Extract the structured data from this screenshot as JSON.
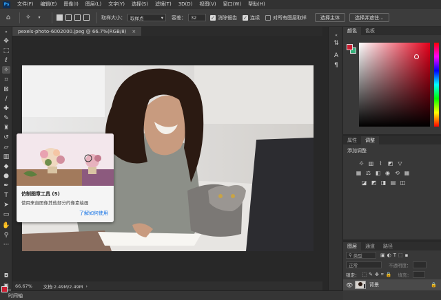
{
  "app": {
    "logo": "Ps"
  },
  "menu": [
    "文件(F)",
    "编辑(E)",
    "图像(I)",
    "图层(L)",
    "文字(Y)",
    "选择(S)",
    "滤镜(T)",
    "3D(D)",
    "视图(V)",
    "窗口(W)",
    "帮助(H)"
  ],
  "options": {
    "sample_size_label": "取样大小：",
    "sample_size_value": "取样点",
    "tolerance_label": "容差：",
    "tolerance_value": "32",
    "antialias_label": "消除锯齿",
    "contiguous_label": "连续",
    "sample_all_label": "对所有图层取样",
    "select_subject_label": "选择主体",
    "select_and_mask_label": "选择并遮住..."
  },
  "document": {
    "tab_title": "pexels-photo-6002000.jpeg @ 66.7%(RGB/8)",
    "close": "×"
  },
  "tooltip": {
    "title": "仿制图章工具 (S)",
    "description": "使用来自图像其他部分的像素绘画",
    "link": "了解如何使用"
  },
  "status": {
    "zoom": "66.67%",
    "doc_size": "文档:2.49M/2.49M",
    "arrow": "›"
  },
  "timeline": {
    "label": "时间轴"
  },
  "color_panel": {
    "tabs": [
      "颜色",
      "色板"
    ],
    "foreground": "#cc2033",
    "background": "#36b07a"
  },
  "adjust_panel": {
    "tabs": [
      "属性",
      "调整"
    ],
    "title": "添加调整"
  },
  "layers_panel": {
    "tabs": [
      "图层",
      "通道",
      "路径"
    ],
    "kind_label": "类型",
    "blend_mode": "正常",
    "opacity_label": "不透明度：",
    "lock_label": "锁定：",
    "fill_label": "填充：",
    "layer_name": "背景"
  }
}
